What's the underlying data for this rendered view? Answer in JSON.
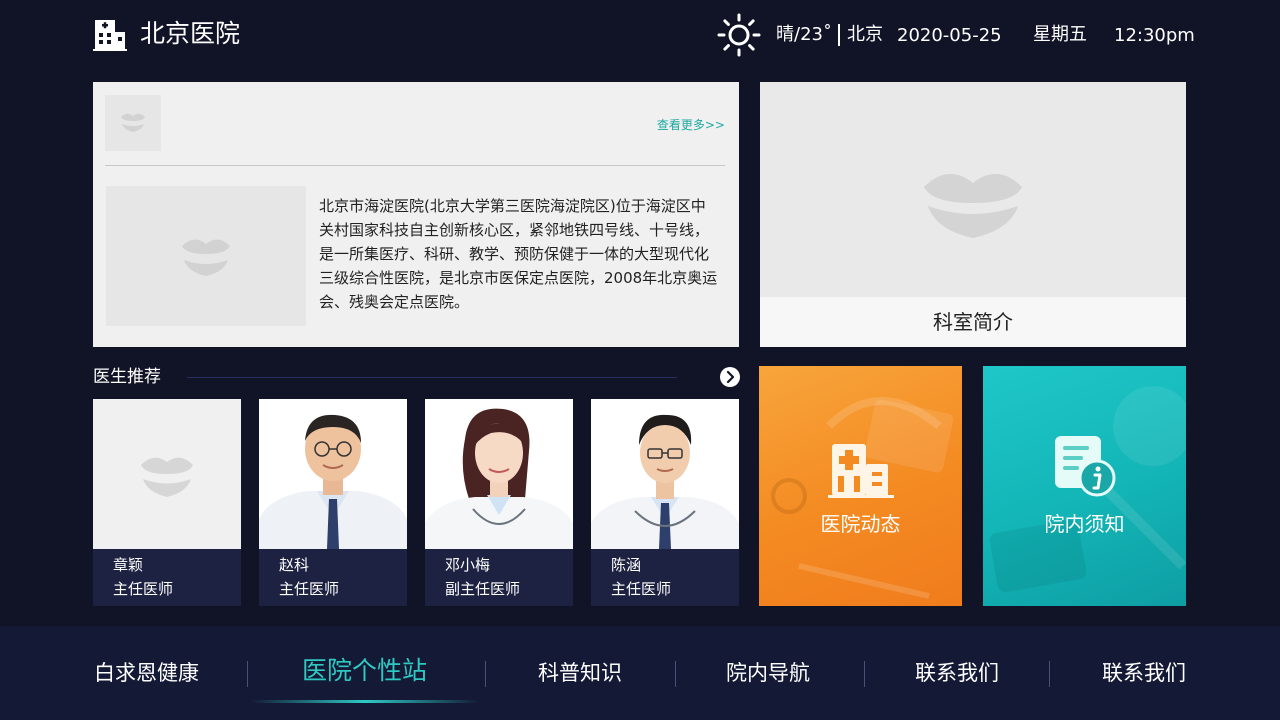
{
  "header": {
    "hospital_name": "北京医院",
    "weather": "晴/23˚",
    "city": "北京",
    "date": "2020-05-25",
    "weekday": "星期五",
    "time": "12:30pm"
  },
  "intro": {
    "more_link": "查看更多>>",
    "description": "北京市海淀医院(北京大学第三医院海淀院区)位于海淀区中关村国家科技自主创新核心区，紧邻地铁四号线、十号线，是一所集医疗、科研、教学、预防保健于一体的大型现代化三级综合性医院，是北京市医保定点医院，2008年北京奥运会、残奥会定点医院。"
  },
  "department": {
    "label": "科室简介"
  },
  "doctors": {
    "title": "医生推荐",
    "items": [
      {
        "name": "章颖",
        "role": "主任医师"
      },
      {
        "name": "赵科",
        "role": "主任医师"
      },
      {
        "name": "邓小梅",
        "role": "副主任医师"
      },
      {
        "name": "陈涵",
        "role": "主任医师"
      }
    ]
  },
  "tiles": {
    "news": "医院动态",
    "notice": "院内须知"
  },
  "nav": {
    "items": [
      "白求恩健康",
      "医院个性站",
      "科普知识",
      "院内导航",
      "联系我们",
      "联系我们"
    ],
    "active_index": 1
  },
  "colors": {
    "background": "#111427",
    "accent": "#2ec9c3",
    "orange_tile": "#f48a22",
    "teal_tile": "#13b5b6",
    "link": "#1ea9a0"
  }
}
